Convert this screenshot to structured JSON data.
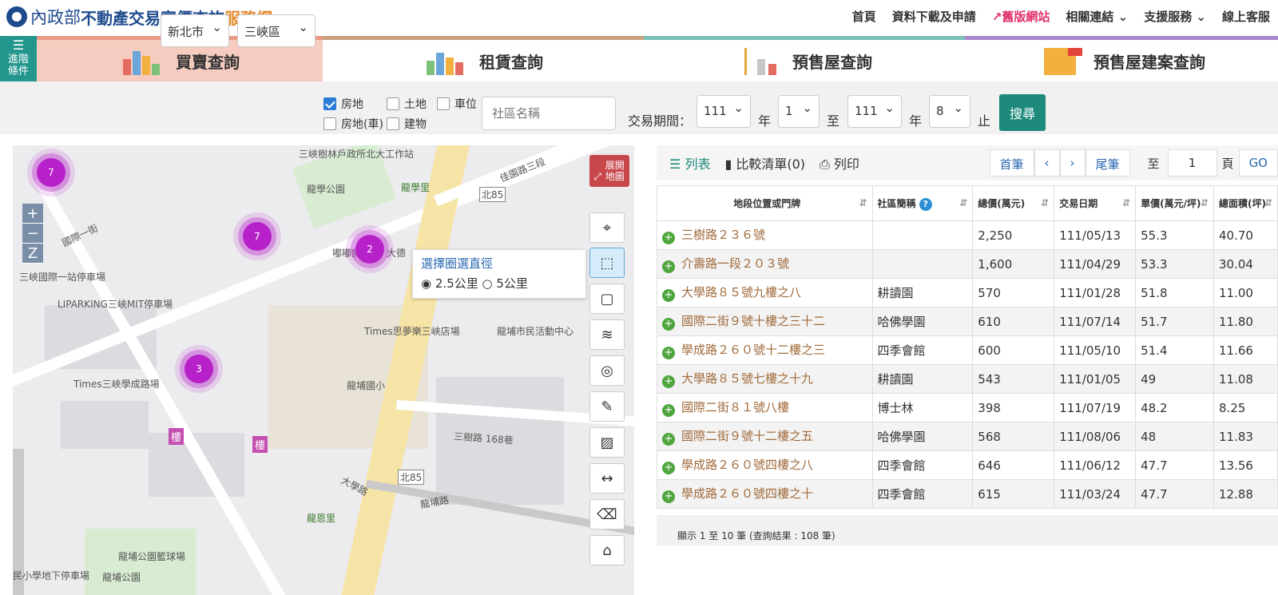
{
  "header": {
    "org": "內政部",
    "site_main": "不動產交易實價查詢",
    "site_suffix": "服務網",
    "nav": [
      {
        "label": "首頁"
      },
      {
        "label": "資料下載及申請"
      },
      {
        "label": "舊版網站"
      },
      {
        "label": "相關連結 ⌄"
      },
      {
        "label": "支援服務 ⌄"
      },
      {
        "label": "線上客服"
      }
    ]
  },
  "tabs": {
    "advanced": "進階條件",
    "items": [
      "買賣查詢",
      "租賃查詢",
      "預售屋查詢",
      "預售屋建案查詢"
    ]
  },
  "filter": {
    "city": "新北市",
    "district": "三峽區",
    "types": [
      {
        "label": "房地",
        "checked": true
      },
      {
        "label": "土地",
        "checked": false
      },
      {
        "label": "車位",
        "checked": false
      },
      {
        "label": "房地(車)",
        "checked": false
      },
      {
        "label": "建物",
        "checked": false
      }
    ],
    "community_placeholder": "社區名稱",
    "period_label": "交易期間：",
    "from_year": "111",
    "year_unit": "年",
    "from_month": "1",
    "to_label": "至",
    "to_year": "111",
    "to_month": "8",
    "end_label": "止",
    "search": "搜尋"
  },
  "map": {
    "expand": "展開地圖",
    "popup_title": "選擇圈選直徑",
    "options": [
      "2.5公里",
      "5公里"
    ],
    "selected_option": "2.5公里",
    "clusters": [
      "7",
      "7",
      "2",
      "3"
    ],
    "zoom": [
      "+",
      "−",
      "Z"
    ],
    "labels": [
      "三峽樹林戶政所北大工作站",
      "龍學公園",
      "龍學里",
      "佳園路三段",
      "國際一街",
      "三峽國際一站停車場",
      "LIPARKING三峽MIT停車場",
      "Times思夢樂三峽店場",
      "龍埔市民活動中心",
      "龍埔國小",
      "Times三峽學成路場",
      "三樹路 168巷",
      "大學路",
      "龍恩里",
      "龍埔路",
      "龍埔公園籃球場",
      "民小學地下停車場",
      "龍埔公園",
      "北85",
      "北85",
      "嘟嘟房",
      "大德"
    ],
    "badges": [
      "樓",
      "樓"
    ],
    "tools": [
      "location-pin",
      "circle-select",
      "rect-select",
      "layers",
      "target",
      "draw",
      "area",
      "ruler",
      "eraser",
      "building"
    ]
  },
  "list": {
    "toolbar": [
      "列表",
      "比較清單(0)",
      "列印"
    ],
    "pager": {
      "first": "首筆",
      "prev": "‹",
      "next": "›",
      "last": "尾筆",
      "to": "至",
      "page": "1",
      "page_unit": "頁",
      "go": "GO"
    },
    "columns": [
      "地段位置或門牌",
      "社區簡稱",
      "總價(萬元)",
      "交易日期",
      "單價(萬元/坪)",
      "總面積(坪)"
    ],
    "rows": [
      [
        "三樹路２３６號",
        "",
        "2,250",
        "111/05/13",
        "55.3",
        "40.70"
      ],
      [
        "介壽路一段２０３號",
        "",
        "1,600",
        "111/04/29",
        "53.3",
        "30.04"
      ],
      [
        "大學路８５號九樓之八",
        "耕讀園",
        "570",
        "111/01/28",
        "51.8",
        "11.00"
      ],
      [
        "國際二街９號十樓之三十二",
        "哈佛學園",
        "610",
        "111/07/14",
        "51.7",
        "11.80"
      ],
      [
        "學成路２６０號十二樓之三",
        "四季會館",
        "600",
        "111/05/10",
        "51.4",
        "11.66"
      ],
      [
        "大學路８５號七樓之十九",
        "耕讀園",
        "543",
        "111/01/05",
        "49",
        "11.08"
      ],
      [
        "國際二街８１號八樓",
        "博士林",
        "398",
        "111/07/19",
        "48.2",
        "8.25"
      ],
      [
        "國際二街９號十二樓之五",
        "哈佛學園",
        "568",
        "111/08/06",
        "48",
        "11.83"
      ],
      [
        "學成路２６０號四樓之八",
        "四季會館",
        "646",
        "111/06/12",
        "47.7",
        "13.56"
      ],
      [
        "學成路２６０號四樓之十",
        "四季會館",
        "615",
        "111/03/24",
        "47.7",
        "12.88"
      ]
    ],
    "footer": "顯示 1 至 10 筆 (查詢結果 : 108 筆)"
  }
}
